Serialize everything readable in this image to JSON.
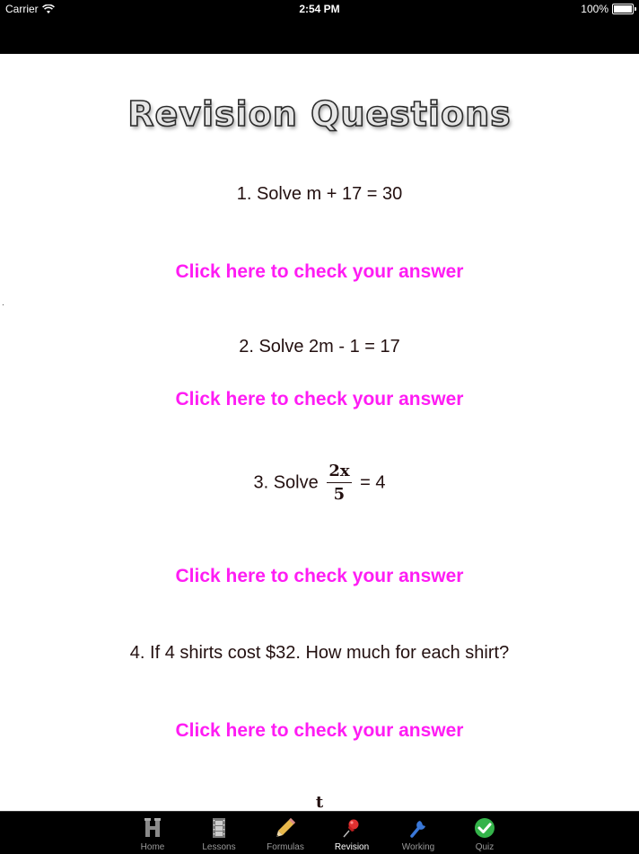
{
  "status": {
    "carrier": "Carrier",
    "time": "2:54 PM",
    "battery": "100%",
    "battery_level": 1.0
  },
  "page": {
    "title": "Revision Questions",
    "stray_mark": "."
  },
  "questions": [
    {
      "prefix": "1.  Solve m  +  17  =  30"
    },
    {
      "prefix": "2.  Solve 2m - 1 =  17"
    },
    {
      "prefix": "3.  Solve ",
      "frac_num": "2x",
      "frac_den": "5",
      "suffix": " = 4"
    },
    {
      "prefix": "4.  If 4 shirts cost $32.  How much for each shirt?"
    }
  ],
  "question5_partial": "t",
  "check_link_label": "Click here to check your answer",
  "colors": {
    "link": "#ff1cf4",
    "text": "#231010",
    "bars": "#000000"
  },
  "tabs": [
    {
      "label": "Home",
      "icon": "home-h-icon"
    },
    {
      "label": "Lessons",
      "icon": "film-icon"
    },
    {
      "label": "Formulas",
      "icon": "pencil-icon"
    },
    {
      "label": "Revision",
      "icon": "pushpin-icon",
      "active": true
    },
    {
      "label": "Working",
      "icon": "wrench-icon"
    },
    {
      "label": "Quiz",
      "icon": "checkmark-icon"
    }
  ]
}
